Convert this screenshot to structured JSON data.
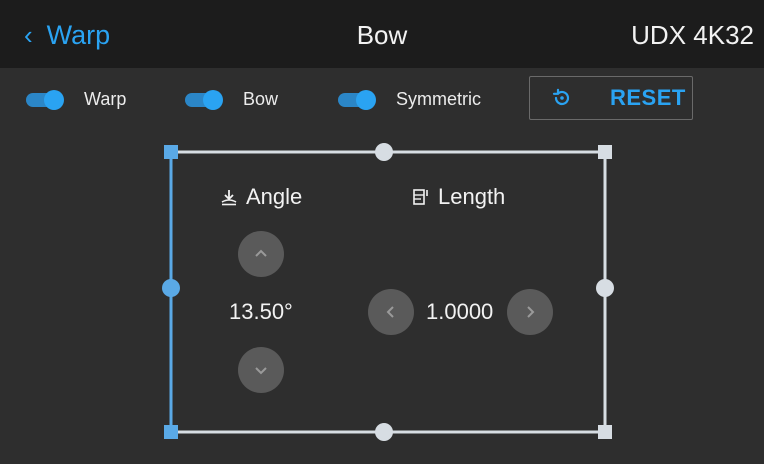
{
  "header": {
    "back_label": "Warp",
    "title": "Bow",
    "model": "UDX 4K32"
  },
  "toolbar": {
    "toggles": [
      {
        "label": "Warp",
        "on": true
      },
      {
        "label": "Bow",
        "on": true
      },
      {
        "label": "Symmetric",
        "on": true
      }
    ],
    "reset_label": "RESET"
  },
  "controls": {
    "angle": {
      "label": "Angle",
      "value": "13.50°"
    },
    "length": {
      "label": "Length",
      "value": "1.0000"
    }
  },
  "colors": {
    "accent": "#2aa3f2",
    "active_edge": "#5aa9e6",
    "inactive_edge": "#d7dde3",
    "background": "#2e2e2e",
    "header": "#1c1c1c"
  }
}
